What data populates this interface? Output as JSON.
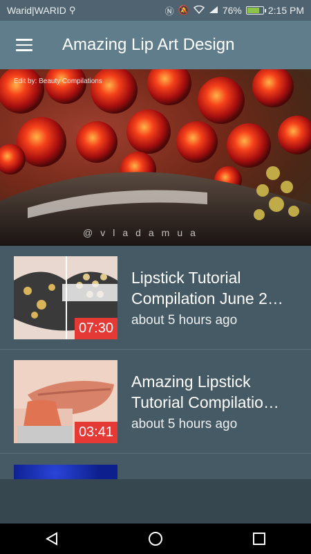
{
  "status_bar": {
    "carrier": "Warid|WARID",
    "battery": "76%",
    "battery_level": 0.76,
    "time": "2:15 PM",
    "icons": [
      "usb-icon",
      "nfc-icon",
      "mute-icon",
      "wifi-icon",
      "signal-icon",
      "battery-icon"
    ]
  },
  "app_bar": {
    "title": "Amazing Lip Art Design",
    "menu_icon": "hamburger-menu-icon"
  },
  "hero": {
    "credit": "Edit by: Beauty Compilations",
    "watermark": "@vladamua"
  },
  "videos": [
    {
      "title": "Lipstick Tutorial Compilation June 2…",
      "time": "about 5 hours ago",
      "duration": "07:30"
    },
    {
      "title": "Amazing Lipstick Tutorial Compilatio…",
      "time": "about 5 hours ago",
      "duration": "03:41"
    }
  ],
  "nav_bar": {
    "icons": [
      "back-icon",
      "home-icon",
      "recents-icon"
    ]
  },
  "colors": {
    "app_bar": "#607d8b",
    "background": "#455a64",
    "duration_badge": "#e53935"
  }
}
